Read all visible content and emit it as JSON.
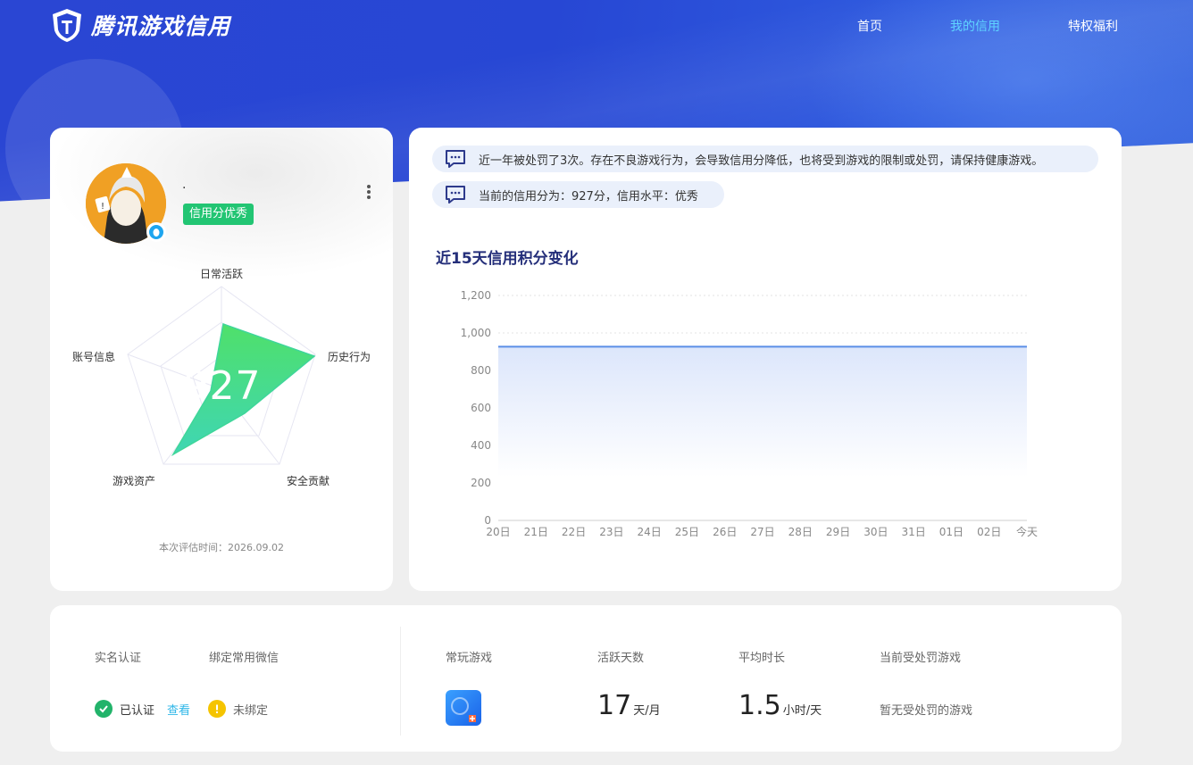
{
  "brand": {
    "name": "腾讯游戏信用"
  },
  "nav": [
    {
      "label": "首页",
      "active": false
    },
    {
      "label": "我的信用",
      "active": true
    },
    {
      "label": "特权福利",
      "active": false
    }
  ],
  "profile": {
    "nickname": "·",
    "badge": "信用分优秀",
    "score": "927",
    "radar_axes": [
      "日常活跃",
      "历史行为",
      "安全贡献",
      "游戏资产",
      "账号信息"
    ],
    "eval_time": "本次评估时间：2026.09.02"
  },
  "notices": [
    "近一年被处罚了3次。存在不良游戏行为，会导致信用分降低，也将受到游戏的限制或处罚，请保持健康游戏。",
    "当前的信用分为：927分，信用水平：优秀"
  ],
  "chart_data": {
    "type": "area",
    "title": "近15天信用积分变化",
    "categories": [
      "20日",
      "21日",
      "22日",
      "23日",
      "24日",
      "25日",
      "26日",
      "27日",
      "28日",
      "29日",
      "30日",
      "31日",
      "01日",
      "02日",
      "今天"
    ],
    "values": [
      927,
      927,
      927,
      927,
      927,
      927,
      927,
      927,
      927,
      927,
      927,
      927,
      927,
      927,
      927
    ],
    "ylim": [
      0,
      1200
    ],
    "yticks": [
      "0",
      "200",
      "400",
      "600",
      "800",
      "1,000",
      "1,200"
    ],
    "grid": true,
    "colors": {
      "line": "#5b8ee6",
      "fill": "#dce6fb"
    }
  },
  "bottom": {
    "realname": {
      "label": "实名认证",
      "status": "已认证",
      "link": "查看"
    },
    "wechat": {
      "label": "绑定常用微信",
      "status": "未绑定"
    },
    "games": {
      "label": "常玩游戏"
    },
    "active_days": {
      "label": "活跃天数",
      "value": "17",
      "unit": "天/月"
    },
    "avg_time": {
      "label": "平均时长",
      "value": "1.5",
      "unit": "小时/天"
    },
    "punished": {
      "label": "当前受处罚游戏",
      "value": "暂无受处罚的游戏"
    }
  },
  "colors": {
    "accent": "#2747d4",
    "nav_active": "#5fd4ff",
    "green": "#22c573",
    "warning": "#f5c400"
  }
}
